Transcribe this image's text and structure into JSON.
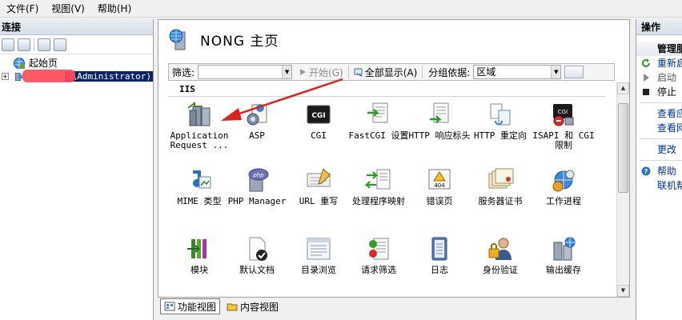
{
  "menu": [
    "文件(F)",
    "视图(V)",
    "帮助(H)"
  ],
  "connections": {
    "title": "连接",
    "start_page": "起始页",
    "server": "G\\Administrator)"
  },
  "center": {
    "title": "NONG 主页",
    "filter_label": "筛选:",
    "start_button": "开始(G)",
    "show_all": "全部显示(A)",
    "group_by_label": "分组依据:",
    "group_by_value": "区域",
    "group": "IIS",
    "features": [
      {
        "label": "Application Request ..."
      },
      {
        "label": "ASP"
      },
      {
        "label": "CGI"
      },
      {
        "label": "FastCGI 设置"
      },
      {
        "label": "HTTP 响应标头"
      },
      {
        "label": "HTTP 重定向"
      },
      {
        "label": "ISAPI 和 CGI 限制"
      },
      {
        "label": "MIME 类型"
      },
      {
        "label": "PHP Manager"
      },
      {
        "label": "URL 重写"
      },
      {
        "label": "处理程序映射"
      },
      {
        "label": "错误页"
      },
      {
        "label": "服务器证书"
      },
      {
        "label": "工作进程"
      },
      {
        "label": "模块"
      },
      {
        "label": "默认文档"
      },
      {
        "label": "目录浏览"
      },
      {
        "label": "请求筛选"
      },
      {
        "label": "日志"
      },
      {
        "label": "身份验证"
      },
      {
        "label": "输出缓存"
      }
    ]
  },
  "view_tabs": {
    "features": "功能视图",
    "content": "内容视图"
  },
  "actions": {
    "title": "操作",
    "manage_heading": "管理服",
    "restart": "重新启",
    "start": "启动",
    "stop": "停止",
    "view_app": "查看应",
    "view_site": "查看网",
    "change": "更改",
    "help": "帮助",
    "online_help": "联机帮"
  },
  "colors": {
    "selection": "#0a246a",
    "link": "#003399",
    "cgi_icon": "#1a1a1a",
    "arrow": "#e02020"
  }
}
